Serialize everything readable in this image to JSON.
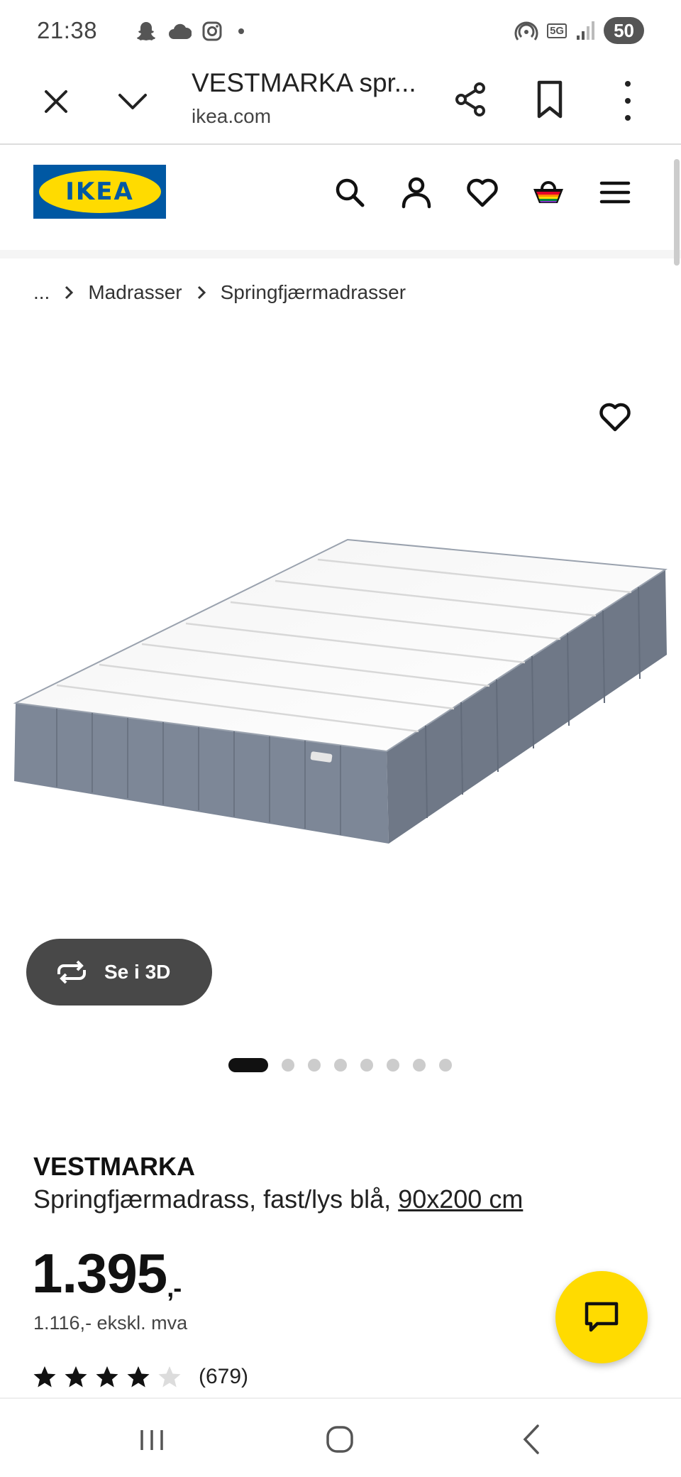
{
  "status_bar": {
    "time": "21:38",
    "network": "5G",
    "battery": "50"
  },
  "tab_bar": {
    "page_title": "VESTMARKA spr...",
    "url": "ikea.com"
  },
  "header": {
    "logo_text": "IKEA",
    "icons": [
      "search-icon",
      "account-icon",
      "favourites-icon",
      "cart-icon",
      "menu-icon"
    ]
  },
  "breadcrumb": {
    "ellipsis": "...",
    "items": [
      "Madrasser",
      "Springfjærmadrasser"
    ]
  },
  "gallery": {
    "view_3d_label": "Se i 3D",
    "image_count": 8,
    "active_index": 0
  },
  "product": {
    "name": "VESTMARKA",
    "description": "Springfjærmadrass, fast/lys blå,",
    "size": "90x200 cm",
    "price_main": "1.395",
    "price_suffix": ",-",
    "price_ex_vat": "1.116,- ekskl. mva",
    "rating": 4,
    "rating_max": 5,
    "review_count": "(679)"
  },
  "colors": {
    "ikea_blue": "#0058a3",
    "ikea_yellow": "#ffdb00",
    "button_dark": "#484848"
  }
}
